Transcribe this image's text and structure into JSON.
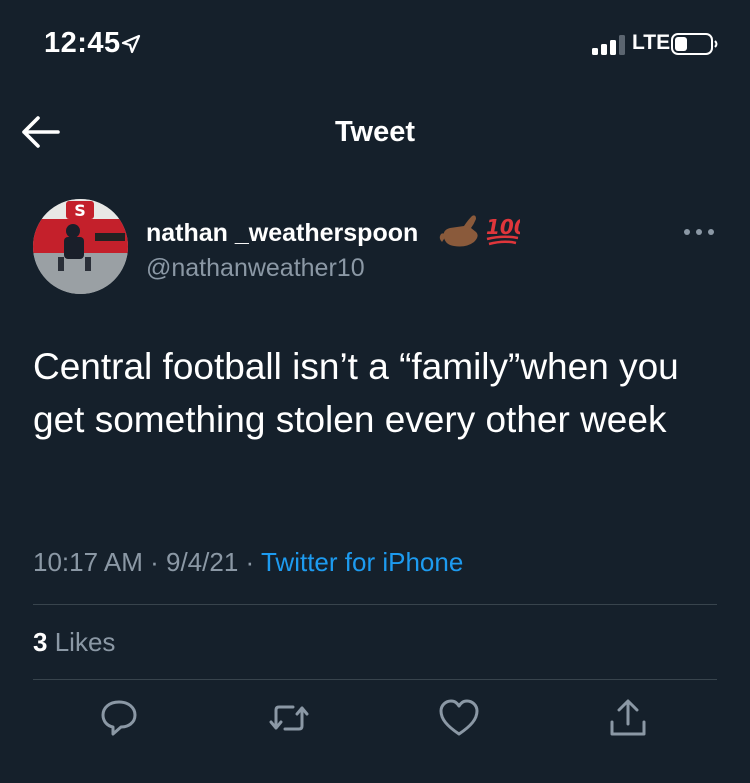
{
  "status_bar": {
    "time": "12:45",
    "network": "LTE"
  },
  "header": {
    "title": "Tweet"
  },
  "tweet": {
    "display_name": "nathan _weatherspoon",
    "handle": "@nathanweather10",
    "text": "Central football isn’t a “family”when you get something stolen every other week",
    "time": "10:17 AM",
    "date": "9/4/21",
    "separator": "·",
    "source": "Twitter for iPhone",
    "likes_count": "3",
    "likes_label": "Likes"
  },
  "icons": {
    "back": "arrow-left-icon",
    "more": "more-horizontal-icon",
    "reply": "reply-icon",
    "retweet": "retweet-icon",
    "like": "heart-icon",
    "share": "share-icon"
  },
  "colors": {
    "background": "#15202b",
    "text": "#ffffff",
    "muted": "#8b98a5",
    "link": "#1d9bf0",
    "divider": "#38444d"
  }
}
